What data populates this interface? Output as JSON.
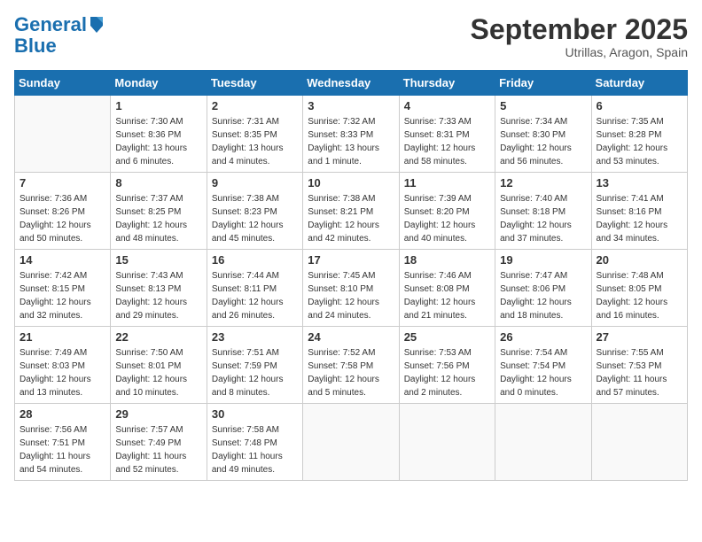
{
  "header": {
    "logo_line1": "General",
    "logo_line2": "Blue",
    "month": "September 2025",
    "location": "Utrillas, Aragon, Spain"
  },
  "weekdays": [
    "Sunday",
    "Monday",
    "Tuesday",
    "Wednesday",
    "Thursday",
    "Friday",
    "Saturday"
  ],
  "weeks": [
    [
      {
        "day": null
      },
      {
        "day": "1",
        "sunrise": "Sunrise: 7:30 AM",
        "sunset": "Sunset: 8:36 PM",
        "daylight": "Daylight: 13 hours and 6 minutes."
      },
      {
        "day": "2",
        "sunrise": "Sunrise: 7:31 AM",
        "sunset": "Sunset: 8:35 PM",
        "daylight": "Daylight: 13 hours and 4 minutes."
      },
      {
        "day": "3",
        "sunrise": "Sunrise: 7:32 AM",
        "sunset": "Sunset: 8:33 PM",
        "daylight": "Daylight: 13 hours and 1 minute."
      },
      {
        "day": "4",
        "sunrise": "Sunrise: 7:33 AM",
        "sunset": "Sunset: 8:31 PM",
        "daylight": "Daylight: 12 hours and 58 minutes."
      },
      {
        "day": "5",
        "sunrise": "Sunrise: 7:34 AM",
        "sunset": "Sunset: 8:30 PM",
        "daylight": "Daylight: 12 hours and 56 minutes."
      },
      {
        "day": "6",
        "sunrise": "Sunrise: 7:35 AM",
        "sunset": "Sunset: 8:28 PM",
        "daylight": "Daylight: 12 hours and 53 minutes."
      }
    ],
    [
      {
        "day": "7",
        "sunrise": "Sunrise: 7:36 AM",
        "sunset": "Sunset: 8:26 PM",
        "daylight": "Daylight: 12 hours and 50 minutes."
      },
      {
        "day": "8",
        "sunrise": "Sunrise: 7:37 AM",
        "sunset": "Sunset: 8:25 PM",
        "daylight": "Daylight: 12 hours and 48 minutes."
      },
      {
        "day": "9",
        "sunrise": "Sunrise: 7:38 AM",
        "sunset": "Sunset: 8:23 PM",
        "daylight": "Daylight: 12 hours and 45 minutes."
      },
      {
        "day": "10",
        "sunrise": "Sunrise: 7:38 AM",
        "sunset": "Sunset: 8:21 PM",
        "daylight": "Daylight: 12 hours and 42 minutes."
      },
      {
        "day": "11",
        "sunrise": "Sunrise: 7:39 AM",
        "sunset": "Sunset: 8:20 PM",
        "daylight": "Daylight: 12 hours and 40 minutes."
      },
      {
        "day": "12",
        "sunrise": "Sunrise: 7:40 AM",
        "sunset": "Sunset: 8:18 PM",
        "daylight": "Daylight: 12 hours and 37 minutes."
      },
      {
        "day": "13",
        "sunrise": "Sunrise: 7:41 AM",
        "sunset": "Sunset: 8:16 PM",
        "daylight": "Daylight: 12 hours and 34 minutes."
      }
    ],
    [
      {
        "day": "14",
        "sunrise": "Sunrise: 7:42 AM",
        "sunset": "Sunset: 8:15 PM",
        "daylight": "Daylight: 12 hours and 32 minutes."
      },
      {
        "day": "15",
        "sunrise": "Sunrise: 7:43 AM",
        "sunset": "Sunset: 8:13 PM",
        "daylight": "Daylight: 12 hours and 29 minutes."
      },
      {
        "day": "16",
        "sunrise": "Sunrise: 7:44 AM",
        "sunset": "Sunset: 8:11 PM",
        "daylight": "Daylight: 12 hours and 26 minutes."
      },
      {
        "day": "17",
        "sunrise": "Sunrise: 7:45 AM",
        "sunset": "Sunset: 8:10 PM",
        "daylight": "Daylight: 12 hours and 24 minutes."
      },
      {
        "day": "18",
        "sunrise": "Sunrise: 7:46 AM",
        "sunset": "Sunset: 8:08 PM",
        "daylight": "Daylight: 12 hours and 21 minutes."
      },
      {
        "day": "19",
        "sunrise": "Sunrise: 7:47 AM",
        "sunset": "Sunset: 8:06 PM",
        "daylight": "Daylight: 12 hours and 18 minutes."
      },
      {
        "day": "20",
        "sunrise": "Sunrise: 7:48 AM",
        "sunset": "Sunset: 8:05 PM",
        "daylight": "Daylight: 12 hours and 16 minutes."
      }
    ],
    [
      {
        "day": "21",
        "sunrise": "Sunrise: 7:49 AM",
        "sunset": "Sunset: 8:03 PM",
        "daylight": "Daylight: 12 hours and 13 minutes."
      },
      {
        "day": "22",
        "sunrise": "Sunrise: 7:50 AM",
        "sunset": "Sunset: 8:01 PM",
        "daylight": "Daylight: 12 hours and 10 minutes."
      },
      {
        "day": "23",
        "sunrise": "Sunrise: 7:51 AM",
        "sunset": "Sunset: 7:59 PM",
        "daylight": "Daylight: 12 hours and 8 minutes."
      },
      {
        "day": "24",
        "sunrise": "Sunrise: 7:52 AM",
        "sunset": "Sunset: 7:58 PM",
        "daylight": "Daylight: 12 hours and 5 minutes."
      },
      {
        "day": "25",
        "sunrise": "Sunrise: 7:53 AM",
        "sunset": "Sunset: 7:56 PM",
        "daylight": "Daylight: 12 hours and 2 minutes."
      },
      {
        "day": "26",
        "sunrise": "Sunrise: 7:54 AM",
        "sunset": "Sunset: 7:54 PM",
        "daylight": "Daylight: 12 hours and 0 minutes."
      },
      {
        "day": "27",
        "sunrise": "Sunrise: 7:55 AM",
        "sunset": "Sunset: 7:53 PM",
        "daylight": "Daylight: 11 hours and 57 minutes."
      }
    ],
    [
      {
        "day": "28",
        "sunrise": "Sunrise: 7:56 AM",
        "sunset": "Sunset: 7:51 PM",
        "daylight": "Daylight: 11 hours and 54 minutes."
      },
      {
        "day": "29",
        "sunrise": "Sunrise: 7:57 AM",
        "sunset": "Sunset: 7:49 PM",
        "daylight": "Daylight: 11 hours and 52 minutes."
      },
      {
        "day": "30",
        "sunrise": "Sunrise: 7:58 AM",
        "sunset": "Sunset: 7:48 PM",
        "daylight": "Daylight: 11 hours and 49 minutes."
      },
      {
        "day": null
      },
      {
        "day": null
      },
      {
        "day": null
      },
      {
        "day": null
      }
    ]
  ]
}
